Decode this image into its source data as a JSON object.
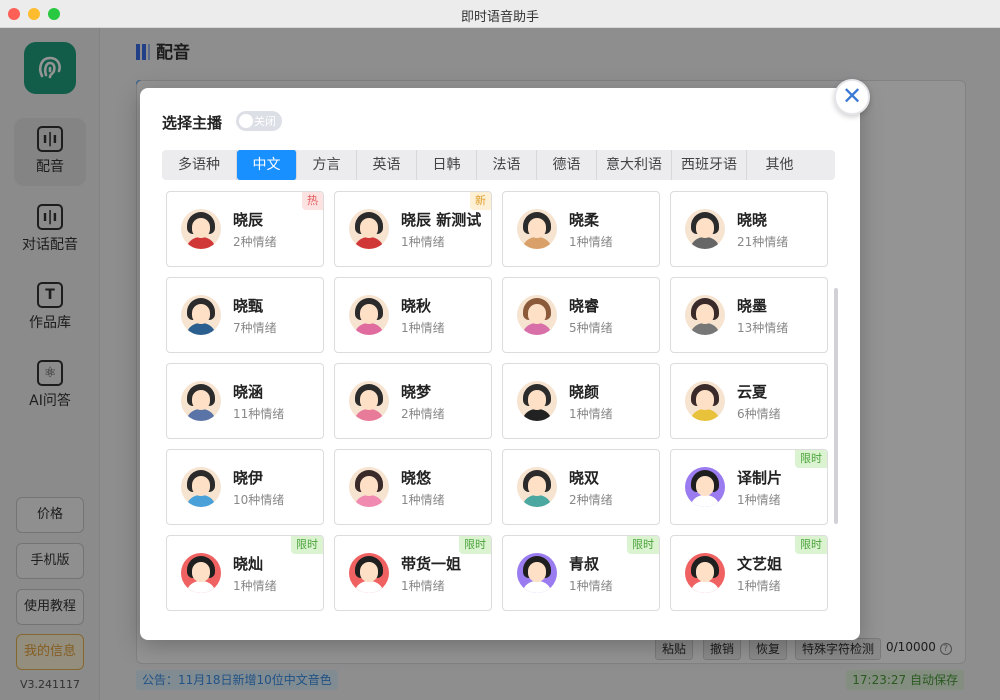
{
  "window": {
    "title": "即时语音助手"
  },
  "sidebar": {
    "nav": [
      {
        "label": "配音",
        "icon": "waveform-icon",
        "glyph": "ı|ı"
      },
      {
        "label": "对话配音",
        "icon": "dialog-waveform-icon",
        "glyph": "ı|ı"
      },
      {
        "label": "作品库",
        "icon": "text-box-icon",
        "glyph": "T"
      },
      {
        "label": "AI问答",
        "icon": "atom-icon",
        "glyph": "⚛"
      }
    ],
    "buttons": [
      "价格",
      "手机版",
      "使用教程",
      "我的信息"
    ],
    "version": "V3.241117"
  },
  "main": {
    "title": "配音",
    "tools": [
      "粘贴",
      "撤销",
      "恢复",
      "特殊字符检测"
    ],
    "char_count": "0/10000",
    "notice": "公告：11月18日新增10位中文音色",
    "autosave": "17:23:27 自动保存"
  },
  "modal": {
    "title": "选择主播",
    "toggle_label": "关闭",
    "close_glyph": "✕",
    "tabs": [
      "多语种",
      "中文",
      "方言",
      "英语",
      "日韩",
      "法语",
      "德语",
      "意大利语",
      "西班牙语",
      "其他"
    ],
    "active_tab": "中文",
    "voices": [
      {
        "name": "晓辰",
        "emotions": "2种情绪",
        "badge": "热",
        "badge_type": "hot",
        "hair": "#2b2b2b",
        "body": "#d03838",
        "bg": "#f6e3d0"
      },
      {
        "name": "晓辰 新测试",
        "emotions": "1种情绪",
        "badge": "新",
        "badge_type": "new",
        "hair": "#2b2b2b",
        "body": "#d03838",
        "bg": "#f6e3d0"
      },
      {
        "name": "晓柔",
        "emotions": "1种情绪",
        "badge": "",
        "badge_type": "",
        "hair": "#2b2b2b",
        "body": "#d9a06a",
        "bg": "#f6e3d0"
      },
      {
        "name": "晓晓",
        "emotions": "21种情绪",
        "badge": "",
        "badge_type": "",
        "hair": "#2b2b2b",
        "body": "#666666",
        "bg": "#f6e3d0"
      },
      {
        "name": "晓甄",
        "emotions": "7种情绪",
        "badge": "",
        "badge_type": "",
        "hair": "#2b2b2b",
        "body": "#2b5f8f",
        "bg": "#f6e3d0"
      },
      {
        "name": "晓秋",
        "emotions": "1种情绪",
        "badge": "",
        "badge_type": "",
        "hair": "#2b2b2b",
        "body": "#e06c9f",
        "bg": "#f6e3d0"
      },
      {
        "name": "晓睿",
        "emotions": "5种情绪",
        "badge": "",
        "badge_type": "",
        "hair": "#8a5a3a",
        "body": "#d86fa8",
        "bg": "#f6e3d0"
      },
      {
        "name": "晓墨",
        "emotions": "13种情绪",
        "badge": "",
        "badge_type": "",
        "hair": "#3a2a2a",
        "body": "#777777",
        "bg": "#f6e3d0"
      },
      {
        "name": "晓涵",
        "emotions": "11种情绪",
        "badge": "",
        "badge_type": "",
        "hair": "#2b2b2b",
        "body": "#5a74a8",
        "bg": "#f6e3d0"
      },
      {
        "name": "晓梦",
        "emotions": "2种情绪",
        "badge": "",
        "badge_type": "",
        "hair": "#2b2b2b",
        "body": "#e87a9a",
        "bg": "#f6e3d0"
      },
      {
        "name": "晓颜",
        "emotions": "1种情绪",
        "badge": "",
        "badge_type": "",
        "hair": "#2b2b2b",
        "body": "#222222",
        "bg": "#f6e3d0"
      },
      {
        "name": "云夏",
        "emotions": "6种情绪",
        "badge": "",
        "badge_type": "",
        "hair": "#3a2a2a",
        "body": "#e8c23a",
        "bg": "#f6e3d0"
      },
      {
        "name": "晓伊",
        "emotions": "10种情绪",
        "badge": "",
        "badge_type": "",
        "hair": "#2b2b2b",
        "body": "#4aa0d8",
        "bg": "#f6e3d0"
      },
      {
        "name": "晓悠",
        "emotions": "1种情绪",
        "badge": "",
        "badge_type": "",
        "hair": "#3a2a2a",
        "body": "#f08ab0",
        "bg": "#f6e3d0"
      },
      {
        "name": "晓双",
        "emotions": "2种情绪",
        "badge": "",
        "badge_type": "",
        "hair": "#2b2b2b",
        "body": "#4aa8a0",
        "bg": "#f6e3d0"
      },
      {
        "name": "译制片",
        "emotions": "1种情绪",
        "badge": "限时",
        "badge_type": "limited",
        "hair": "#1f1f1f",
        "body": "#ffffff",
        "bg": "#9a7cf0"
      },
      {
        "name": "晓灿",
        "emotions": "1种情绪",
        "badge": "限时",
        "badge_type": "limited",
        "hair": "#1f1f1f",
        "body": "#ffffff",
        "bg": "#f06262"
      },
      {
        "name": "带货一姐",
        "emotions": "1种情绪",
        "badge": "限时",
        "badge_type": "limited",
        "hair": "#1f1f1f",
        "body": "#ffffff",
        "bg": "#f06262"
      },
      {
        "name": "青叔",
        "emotions": "1种情绪",
        "badge": "限时",
        "badge_type": "limited",
        "hair": "#1f1f1f",
        "body": "#ffffff",
        "bg": "#9a7cf0"
      },
      {
        "name": "文艺姐",
        "emotions": "1种情绪",
        "badge": "限时",
        "badge_type": "limited",
        "hair": "#1f1f1f",
        "body": "#ffffff",
        "bg": "#f06262"
      }
    ]
  }
}
